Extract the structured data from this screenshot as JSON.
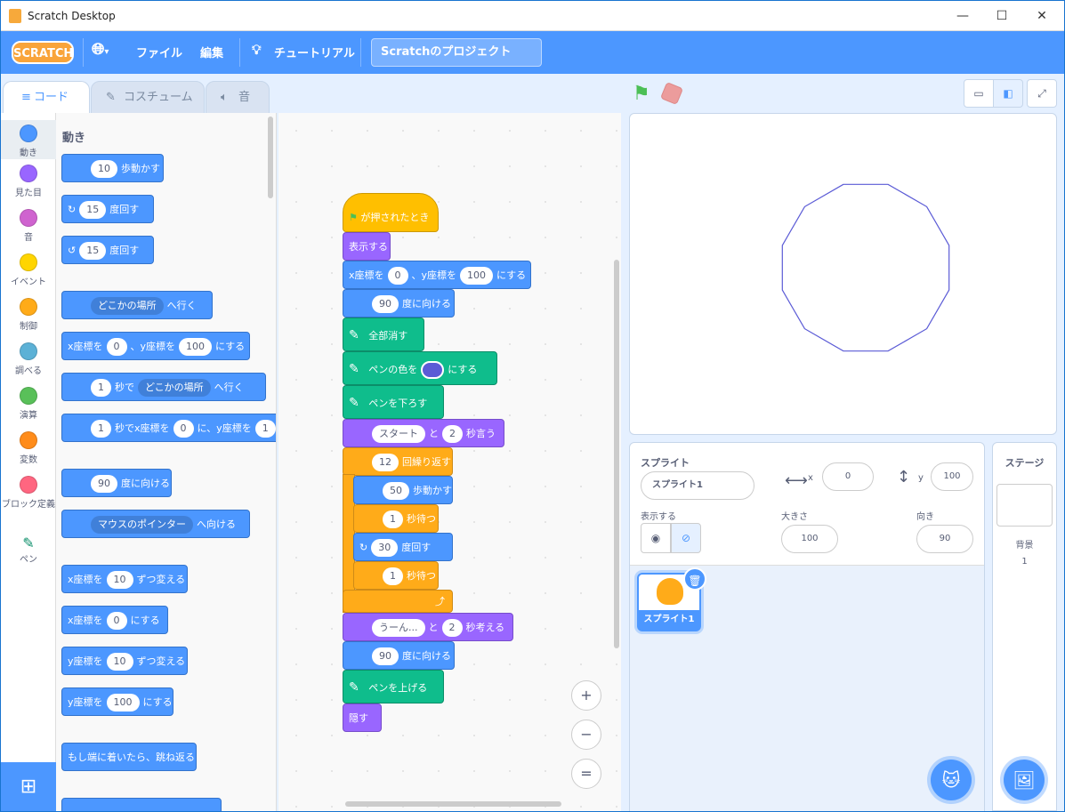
{
  "window": {
    "title": "Scratch Desktop"
  },
  "menubar": {
    "logo": "SCRATCH",
    "file": "ファイル",
    "edit": "編集",
    "tutorials": "チュートリアル",
    "project_title": "Scratchのプロジェクト"
  },
  "tabs": [
    "コード",
    "コスチューム",
    "音"
  ],
  "categories": [
    "動き",
    "見た目",
    "音",
    "イベント",
    "制御",
    "調べる",
    "演算",
    "変数",
    "ブロック定義",
    "ペン"
  ],
  "category_colors": [
    "#4c97ff",
    "#9966ff",
    "#cf63cf",
    "#ffd500",
    "#ffab19",
    "#5cb1d6",
    "#59c059",
    "#ff8c1a",
    "#ff6680",
    "#0fbd8c"
  ],
  "palette": {
    "title": "動き",
    "b1": {
      "v": "10",
      "t": "歩動かす"
    },
    "b2": {
      "v": "15",
      "t": "度回す"
    },
    "b3": {
      "v": "15",
      "t": "度回す"
    },
    "b4": {
      "d": "どこかの場所",
      "t": "へ行く"
    },
    "b5": {
      "a": "x座標を",
      "x": "0",
      "m": "、y座標を",
      "y": "100",
      "t": "にする"
    },
    "b6": {
      "v": "1",
      "a": "秒で",
      "d": "どこかの場所",
      "t": "へ行く"
    },
    "b7": {
      "v": "1",
      "a": "秒でx座標を",
      "x": "0",
      "t": "に、y座標を",
      "y": "1"
    },
    "b8": {
      "v": "90",
      "t": "度に向ける"
    },
    "b9": {
      "d": "マウスのポインター",
      "t": "へ向ける"
    },
    "b10": {
      "a": "x座標を",
      "v": "10",
      "t": "ずつ変える"
    },
    "b11": {
      "a": "x座標を",
      "v": "0",
      "t": "にする"
    },
    "b12": {
      "a": "y座標を",
      "v": "10",
      "t": "ずつ変える"
    },
    "b13": {
      "a": "y座標を",
      "v": "100",
      "t": "にする"
    },
    "b14": {
      "t": "もし端に着いたら、跳ね返る"
    }
  },
  "script": {
    "hat": "が押されたとき",
    "s1": "表示する",
    "s2": {
      "a": "x座標を",
      "x": "0",
      "m": "、y座標を",
      "y": "100",
      "t": "にする"
    },
    "s3": {
      "v": "90",
      "t": "度に向ける"
    },
    "s4": "全部消す",
    "s5": {
      "a": "ペンの色を",
      "t": "にする",
      "color": "#5b5bd6"
    },
    "s6": "ペンを下ろす",
    "s7": {
      "v": "スタート",
      "m": "と",
      "s": "2",
      "t": "秒言う"
    },
    "s8": {
      "v": "12",
      "t": "回繰り返す"
    },
    "s9": {
      "v": "50",
      "t": "歩動かす"
    },
    "s10": {
      "v": "1",
      "t": "秒待つ"
    },
    "s11": {
      "v": "30",
      "t": "度回す"
    },
    "s12": {
      "v": "1",
      "t": "秒待つ"
    },
    "s13": {
      "v": "うーん...",
      "m": "と",
      "s": "2",
      "t": "秒考える"
    },
    "s14": {
      "v": "90",
      "t": "度に向ける"
    },
    "s15": "ペンを上げる",
    "s16": "隠す"
  },
  "zoom": {
    "in": "+",
    "out": "−",
    "reset": "="
  },
  "sprite": {
    "heading": "スプライト",
    "name": "スプライト1",
    "x_label": "x",
    "x": "0",
    "y_label": "y",
    "y": "100",
    "show_label": "表示する",
    "size_label": "大きさ",
    "size": "100",
    "dir_label": "向き",
    "dir": "90",
    "thumb_label": "スプライト1"
  },
  "stage_panel": {
    "title": "ステージ",
    "backdrops_label": "背景",
    "backdrops": "1"
  },
  "polygon": {
    "sides": 12,
    "color": "#5b5bd6"
  }
}
